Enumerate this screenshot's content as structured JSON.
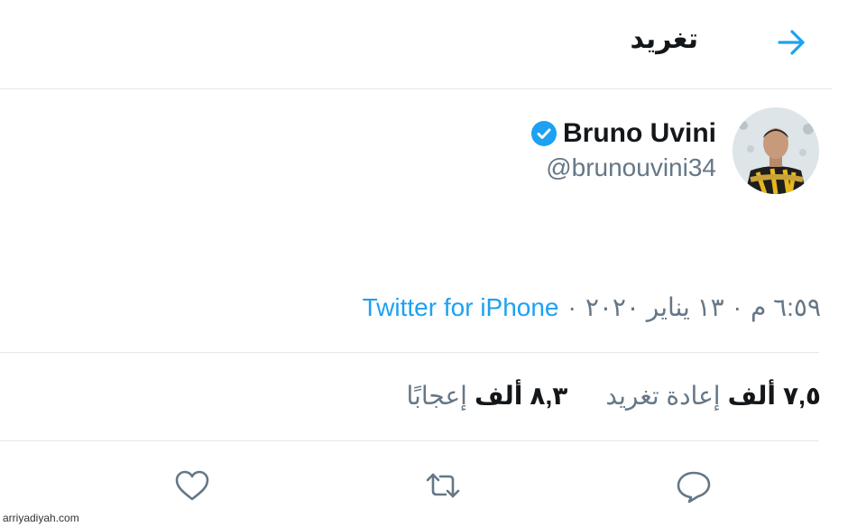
{
  "header": {
    "title": "تغريد",
    "back_icon": "arrow-right-icon"
  },
  "tweet": {
    "display_name": "Bruno Uvini",
    "handle": "@brunouvini34",
    "verified": true,
    "time": "٦:٥٩ م",
    "date": "١٣ يناير ٢٠٢٠",
    "separator": "·",
    "source": "Twitter for iPhone"
  },
  "stats": {
    "retweets": {
      "number": "٧,٥",
      "unit": "ألف",
      "label": "إعادة تغريد"
    },
    "likes": {
      "number": "٨,٣",
      "unit": "ألف",
      "label": "إعجابًا"
    }
  },
  "actions": [
    "reply-icon",
    "retweet-icon",
    "like-icon"
  ],
  "footer": {
    "watermark": "arriyadiyah.com"
  },
  "colors": {
    "accent": "#1da1f2",
    "text": "#14171a",
    "muted": "#657786",
    "divider": "#e1e8ed"
  }
}
